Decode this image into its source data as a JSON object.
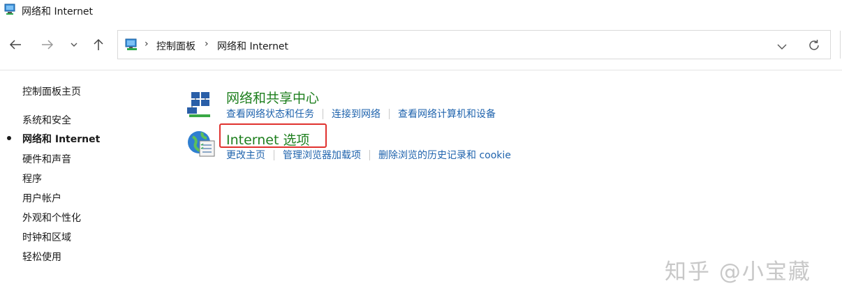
{
  "window": {
    "title": "网络和 Internet"
  },
  "address_bar": {
    "crumbs": [
      "控制面板",
      "网络和 Internet"
    ]
  },
  "sidebar": {
    "home": "控制面板主页",
    "items": [
      {
        "label": "系统和安全",
        "active": false
      },
      {
        "label": "网络和 Internet",
        "active": true
      },
      {
        "label": "硬件和声音",
        "active": false
      },
      {
        "label": "程序",
        "active": false
      },
      {
        "label": "用户帐户",
        "active": false
      },
      {
        "label": "外观和个性化",
        "active": false
      },
      {
        "label": "时钟和区域",
        "active": false
      },
      {
        "label": "轻松使用",
        "active": false
      }
    ]
  },
  "categories": [
    {
      "title": "网络和共享中心",
      "icon": "network-sharing-icon",
      "links": [
        "查看网络状态和任务",
        "连接到网络",
        "查看网络计算机和设备"
      ]
    },
    {
      "title": "Internet 选项",
      "icon": "internet-options-icon",
      "links": [
        "更改主页",
        "管理浏览器加载项",
        "删除浏览的历史记录和 cookie"
      ]
    }
  ],
  "watermark": "知乎 @小宝藏",
  "colors": {
    "category_title": "#1e7f1e",
    "link": "#1f63ad",
    "highlight": "#e0312e"
  }
}
